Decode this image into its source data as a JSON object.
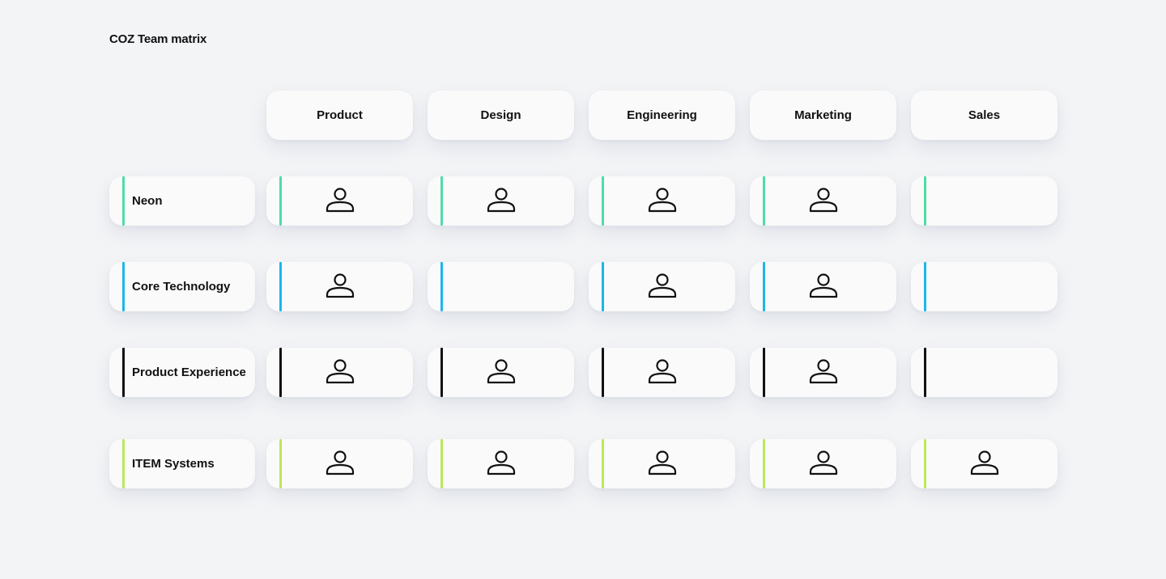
{
  "title": "COZ Team matrix",
  "icon": "person-icon",
  "columns": [
    {
      "label": "Product"
    },
    {
      "label": "Design"
    },
    {
      "label": "Engineering"
    },
    {
      "label": "Marketing"
    },
    {
      "label": "Sales"
    }
  ],
  "rows": [
    {
      "label": "Neon",
      "color": "#4fdca7",
      "filled": [
        true,
        true,
        true,
        true,
        false
      ]
    },
    {
      "label": "Core Technology",
      "color": "#1bb6ec",
      "filled": [
        true,
        false,
        true,
        true,
        false
      ]
    },
    {
      "label": "Product Experience",
      "color": "#111111",
      "filled": [
        true,
        true,
        true,
        true,
        false
      ]
    },
    {
      "label": "ITEM Systems",
      "color": "#b9e95a",
      "filled": [
        true,
        true,
        true,
        true,
        true
      ]
    }
  ]
}
